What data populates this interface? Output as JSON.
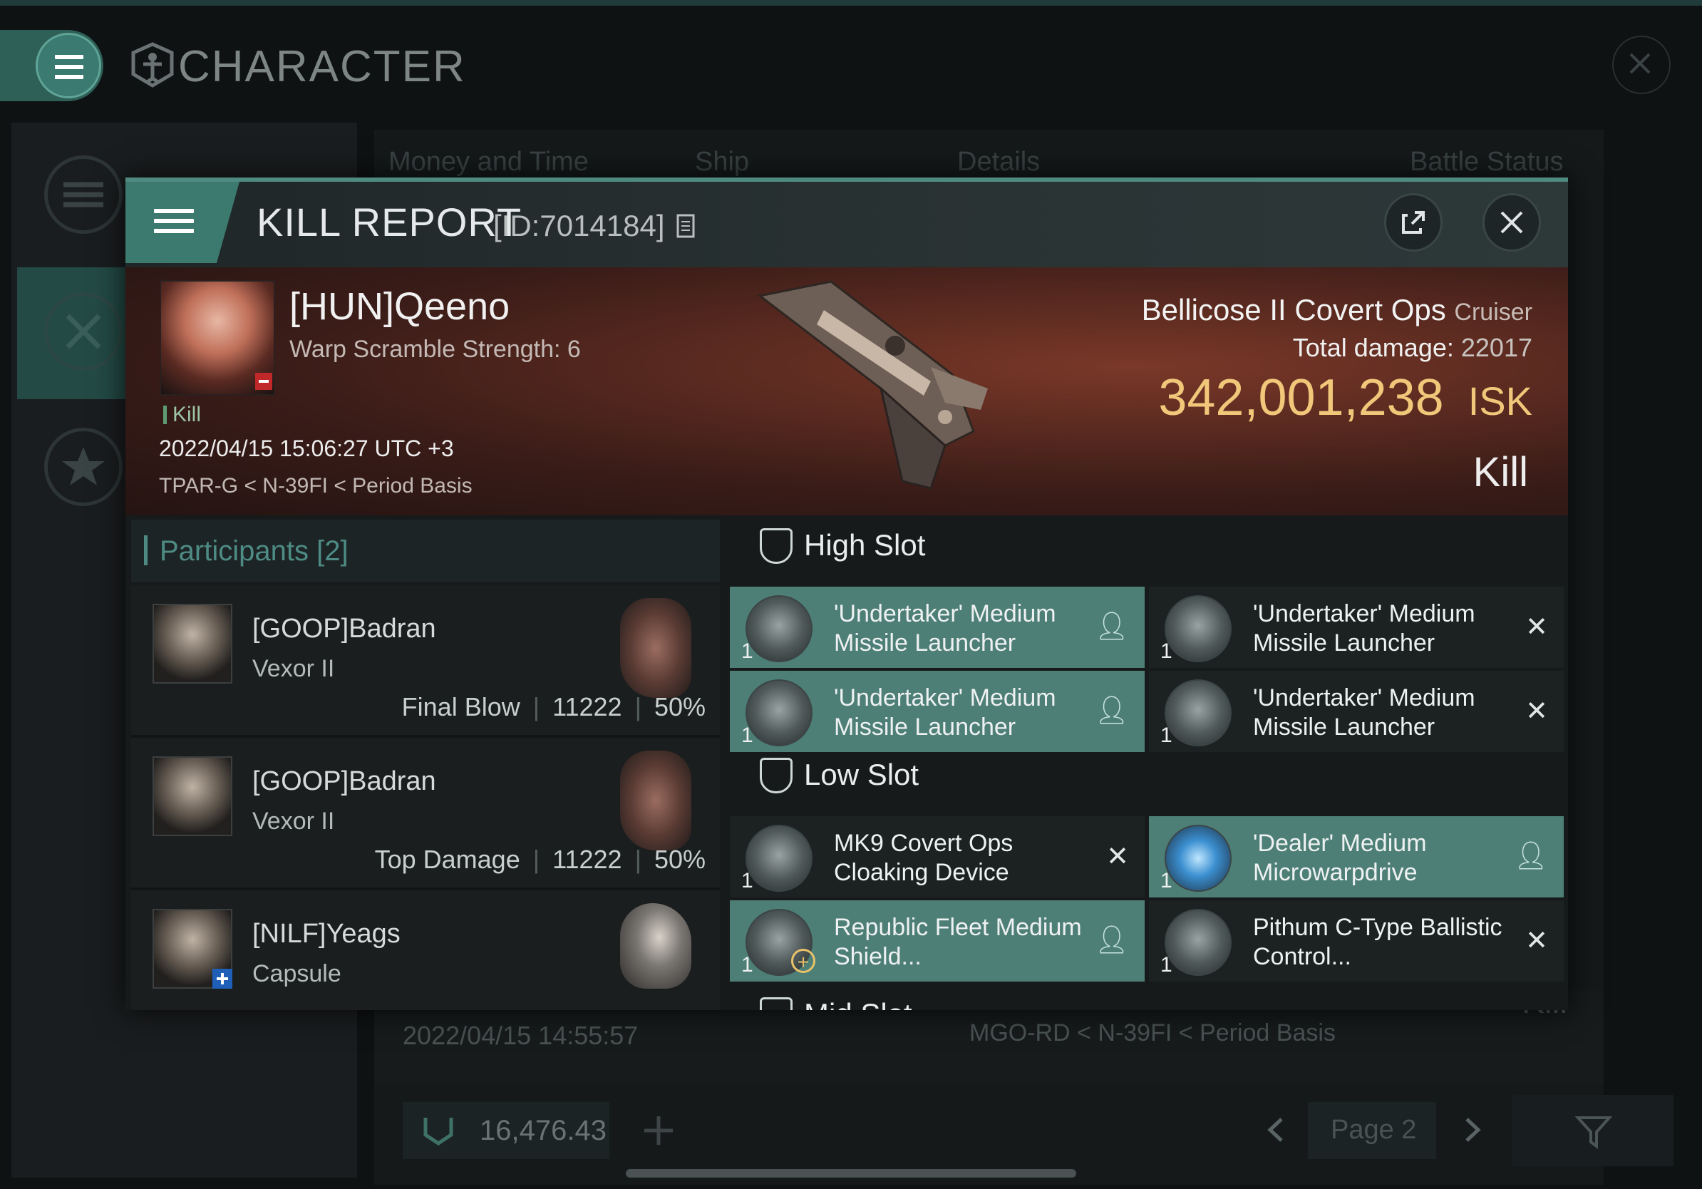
{
  "app": {
    "title": "CHARACTER",
    "tabs": [
      "Money and Time",
      "Ship",
      "Details",
      "Battle Status"
    ]
  },
  "background": {
    "row": {
      "time": "2022/04/15 14:55:57",
      "location": "MGO-RD < N-39FI < Period Basis",
      "result": "Kill"
    },
    "wallet": "16,476.43",
    "page": "Page 2"
  },
  "kill_report": {
    "title": "KILL REPORT",
    "id": "[ID:7014184]",
    "victim": {
      "name": "[HUN]Qeeno",
      "subtitle": "Warp Scramble Strength: 6",
      "tag": "Kill",
      "time": "2022/04/15 15:06:27 UTC +3",
      "location": "TPAR-G < N-39FI < Period Basis"
    },
    "ship": {
      "name": "Bellicose II Covert Ops",
      "class": "Cruiser",
      "damage_label": "Total damage:",
      "damage": "22017",
      "value": "342,001,238",
      "currency": "ISK",
      "result": "Kill"
    },
    "participants": {
      "label": "Participants",
      "count": "[2]",
      "rows": [
        {
          "name": "[GOOP]Badran",
          "ship": "Vexor II",
          "role": "Final Blow",
          "damage": "11222",
          "percent": "50%"
        },
        {
          "name": "[GOOP]Badran",
          "ship": "Vexor II",
          "role": "Top Damage",
          "damage": "11222",
          "percent": "50%"
        },
        {
          "name": "[NILF]Yeags",
          "ship": "Capsule"
        }
      ]
    },
    "high_slot": {
      "label": "High Slot",
      "items": [
        {
          "name": "'Undertaker' Medium Missile Launcher",
          "qty": "1",
          "status": "dropped"
        },
        {
          "name": "'Undertaker' Medium Missile Launcher",
          "qty": "1",
          "status": "destroyed"
        },
        {
          "name": "'Undertaker' Medium Missile Launcher",
          "qty": "1",
          "status": "dropped"
        },
        {
          "name": "'Undertaker' Medium Missile Launcher",
          "qty": "1",
          "status": "destroyed"
        }
      ]
    },
    "low_slot": {
      "label": "Low Slot",
      "items": [
        {
          "name": "MK9 Covert Ops Cloaking Device",
          "qty": "1",
          "status": "destroyed"
        },
        {
          "name": "'Dealer' Medium Microwarpdrive",
          "qty": "1",
          "status": "dropped"
        },
        {
          "name": "Republic Fleet Medium Shield...",
          "qty": "1",
          "status": "dropped"
        },
        {
          "name": "Pithum C-Type Ballistic Control...",
          "qty": "1",
          "status": "destroyed"
        }
      ]
    },
    "mid_slot": {
      "label": "Mid Slot"
    }
  },
  "colors": {
    "accent": "#4d7f77",
    "isk": "#f1c77a",
    "victim_bg": "#5a2a20"
  },
  "icons": [
    "menu-icon",
    "copy-icon",
    "share-icon",
    "close-icon",
    "shield-slot-icon",
    "person-icon",
    "x-icon",
    "star-icon",
    "filter-icon",
    "prev-icon",
    "next-icon",
    "plus-icon"
  ]
}
